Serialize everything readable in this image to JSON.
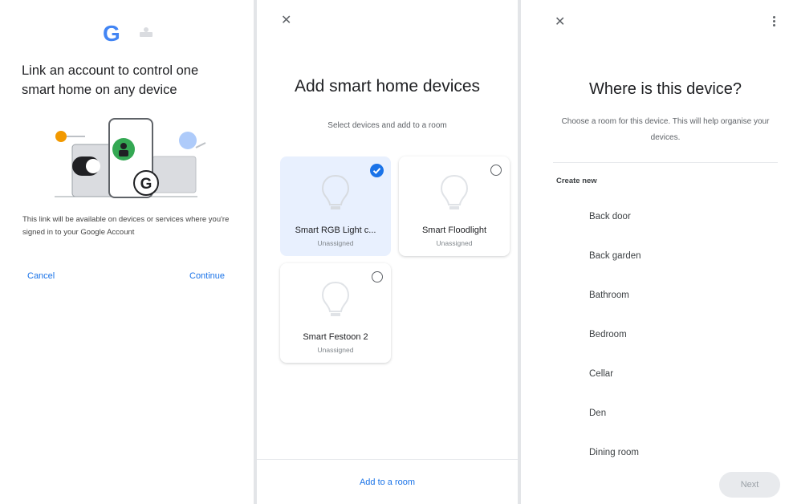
{
  "link_screen": {
    "logo_letters": [
      "G"
    ],
    "title": "Link an account to control one smart home on any device",
    "description": "This link will be available on devices or services where you're signed in to your Google Account",
    "cancel_label": "Cancel",
    "continue_label": "Continue"
  },
  "add_devices_screen": {
    "close_icon": "close-icon",
    "title": "Add smart home devices",
    "subtitle": "Select devices and add to a room",
    "devices": [
      {
        "name": "Smart RGB Light c...",
        "status": "Unassigned",
        "selected": true
      },
      {
        "name": "Smart Floodlight",
        "status": "Unassigned",
        "selected": false
      },
      {
        "name": "Smart Festoon 2",
        "status": "Unassigned",
        "selected": false
      }
    ],
    "footer_button": "Add to a room"
  },
  "room_screen": {
    "close_icon": "close-icon",
    "menu_icon": "more-vert-icon",
    "title": "Where is this device?",
    "subtitle": "Choose a room for this device. This will help organise your devices.",
    "section_label": "Create new",
    "rooms": [
      "Back door",
      "Back garden",
      "Bathroom",
      "Bedroom",
      "Cellar",
      "Den",
      "Dining room"
    ],
    "next_label": "Next"
  },
  "colors": {
    "accent": "#1a73e8",
    "selected_card": "#e8f0fe",
    "disabled_button": "#e8eaed"
  }
}
